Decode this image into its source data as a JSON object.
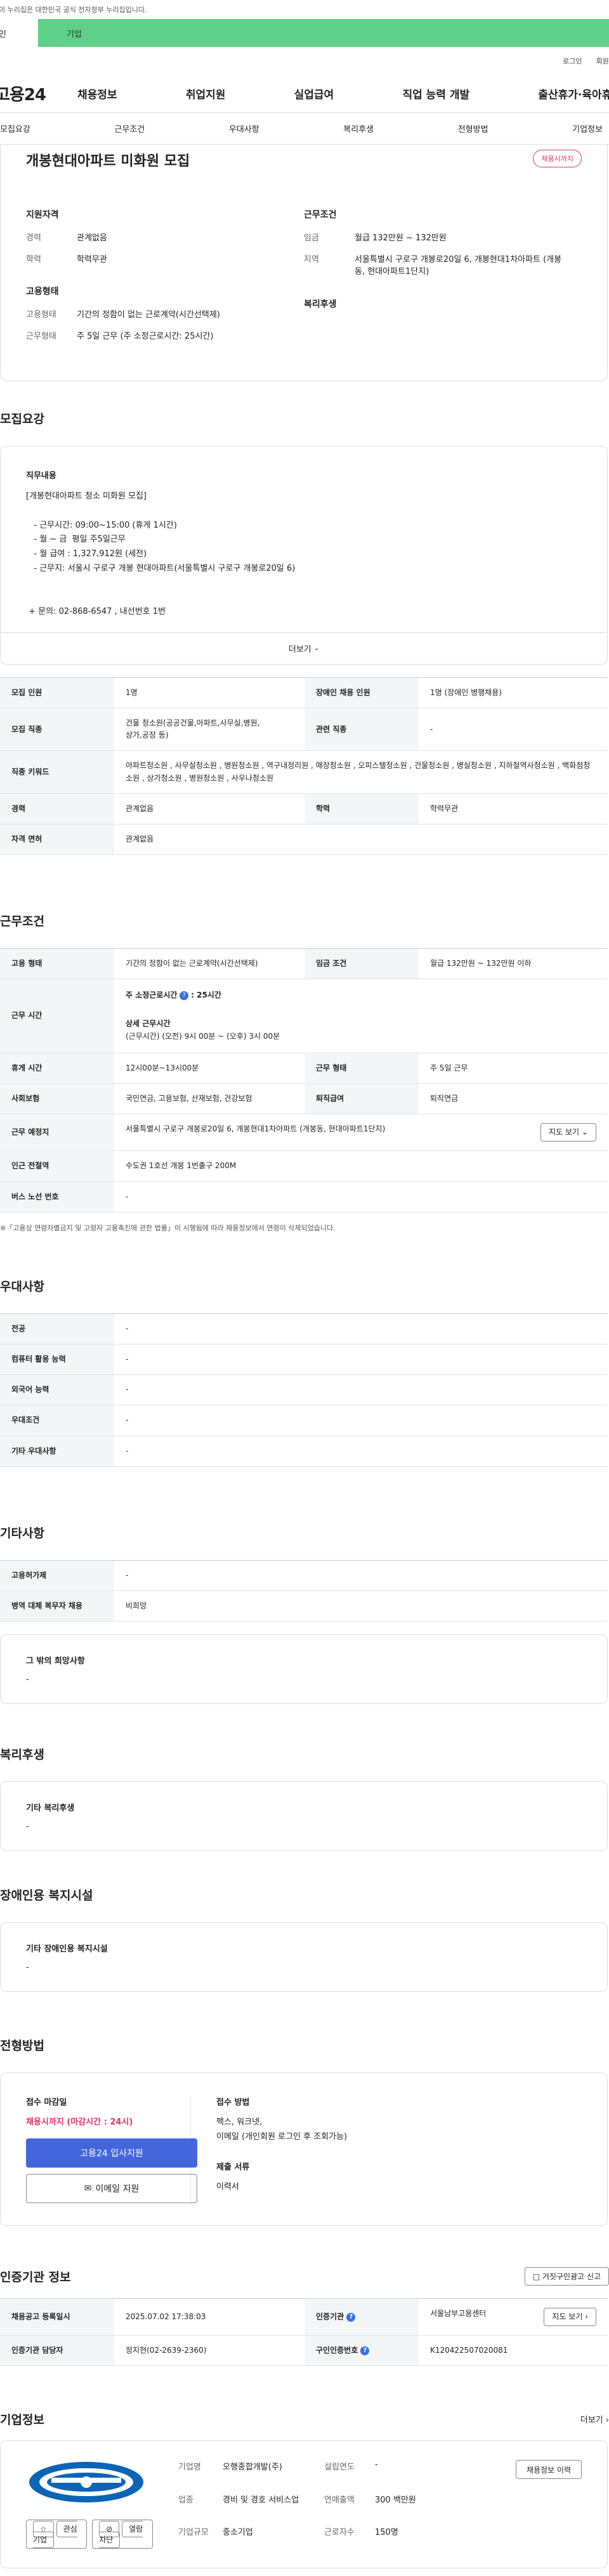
{
  "gov_banner": "이 누리집은 대한민국 공식 전자정부 누리집입니다.",
  "audience_tabs": {
    "individual": "개인",
    "business": "기업"
  },
  "util": {
    "login": "로그인",
    "join": "회원가입"
  },
  "logo": "고용24",
  "gnb": [
    "채용정보",
    "취업지원",
    "실업급여",
    "직업 능력 개발",
    "출산휴가·육아휴직"
  ],
  "subnav": [
    "모집요강",
    "근무조건",
    "우대사항",
    "복리후생",
    "전형방법",
    "기업정보"
  ],
  "summary": {
    "title": "개봉현대아파트 미화원 모집",
    "badge": "채용시까지",
    "qualification": {
      "heading": "지원자격",
      "items": [
        {
          "k": "경력",
          "v": "관계없음"
        },
        {
          "k": "학력",
          "v": "학력무관"
        }
      ]
    },
    "conditions": {
      "heading": "근무조건",
      "items": [
        {
          "k": "임금",
          "v": "월급 132만원 ~ 132만원"
        },
        {
          "k": "지역",
          "v": "서울특별시 구로구 개봉로20일 6, 개봉현대1차아파트 (개봉동, 현대아파트1단지)"
        }
      ]
    },
    "employment": {
      "heading": "고용형태",
      "items": [
        {
          "k": "고용형태",
          "v": "기간의 정함이 없는 근로계약(시간선택제)"
        },
        {
          "k": "근무형태",
          "v": "주 5일 근무 (주 소정근로시간: 25시간)"
        }
      ]
    },
    "welfare_heading": "복리후생"
  },
  "recruit": {
    "title": "모집요강",
    "duty_heading": "직무내용",
    "duty_lines": [
      "[개봉현대아파트 청소 미화원 모집]",
      "",
      "   - 근무시간: 09:00~15:00 (휴게 1시간)",
      "   - 월 ~ 금  평일 주5일근무",
      "   - 월 급여 : 1,327,912원 (세전)",
      "   - 근무지: 서울시 구로구 개봉 현대아파트(서울특별시 구로구 개봉로20일 6)",
      "",
      "",
      " + 문의: 02-868-6547 , 내선번호 1번"
    ],
    "more": "더보기",
    "rows": [
      {
        "k1": "모집 인원",
        "v1": "1명",
        "k2": "장애인 채용 인원",
        "v2": "1명 (장애인 병행채용)"
      },
      {
        "k1": "모집 직종",
        "v1": "건물 청소원(공공건물,아파트,사무실,병원,\n상가,공장 등)",
        "k2": "관련 직종",
        "v2": "-"
      },
      {
        "k1": "직종 키워드",
        "v1": "아파트청소원 , 사무실청소원 , 병원청소원 , 역구내정리원 , 매장청소원 , 오피스텔청소원 , 건물청소원 , 병실청소원 , 지하철역사청소원 , 백화점청소원 , 상가청소원 , 병원청소원 , 사우나청소원"
      },
      {
        "k1": "경력",
        "v1": "관계없음",
        "k2": "학력",
        "v2": "학력무관"
      },
      {
        "k1": "자격 면허",
        "v1": "관계없음"
      }
    ]
  },
  "work": {
    "title": "근무조건",
    "employment_k": "고용 형태",
    "employment_v": "기간의 정함이 없는 근로계약(시간선택제)",
    "wage_k": "임금 조건",
    "wage_v": "월급 132만원 ~ 132만원 이하",
    "hours_k": "근무 시간",
    "hours_weekly_label": "주 소정근로시간",
    "hours_weekly_value": ": 25시간",
    "hours_detail_label": "상세 근무시간",
    "hours_detail_value": "(근무시간) (오전) 9시 00분 ~ (오후) 3시 00분",
    "rest_k": "휴게 시간",
    "rest_v": "12시00분~13시00분",
    "form_k": "근무 형태",
    "form_v": "주 5일 근무",
    "ins_k": "사회보험",
    "ins_v": "국민연금, 고용보험, 산재보험, 건강보험",
    "sev_k": "퇴직급여",
    "sev_v": "퇴직연금",
    "place_k": "근무 예정지",
    "place_v": "서울특별시 구로구 개봉로20일 6, 개봉현대1차아파트 (개봉동, 현대아파트1단지)",
    "map_btn": "지도 보기",
    "subway_k": "인근 전철역",
    "subway_v": "수도권 1호선 개봉 1번출구 200M",
    "bus_k": "버스 노선 번호",
    "bus_v": "-",
    "note": "※「고용상 연령차별금지 및 고령자 고용촉진에 관한 법률」이 시행됨에 따라 채용정보에서 연령이 삭제되었습니다."
  },
  "preference": {
    "title": "우대사항",
    "rows": [
      {
        "k": "전공",
        "v": "-"
      },
      {
        "k": "컴퓨터 활용 능력",
        "v": "-"
      },
      {
        "k": "외국어 능력",
        "v": "-"
      },
      {
        "k": "우대조건",
        "v": "-"
      },
      {
        "k": "기타 우대사항",
        "v": "-"
      }
    ]
  },
  "etc": {
    "title": "기타사항",
    "rows": [
      {
        "k": "고용허가제",
        "v": "-"
      },
      {
        "k": "병역 대체 복무자 채용",
        "v": "비희망"
      }
    ],
    "other_heading": "그 밖의 희망사항",
    "other_value": "-"
  },
  "welfare": {
    "title": "복리후생",
    "heading": "기타 복리후생",
    "value": "-"
  },
  "disabled": {
    "title": "장애인용 복지시설",
    "heading": "기타 장애인용 복지시설",
    "value": "-"
  },
  "selection": {
    "title": "전형방법",
    "deadline_heading": "접수 마감일",
    "deadline": "채용시까지 (마감시간 : 24시)",
    "apply_btn": "고용24 입사지원",
    "email_btn": "이메일 지원",
    "method_heading": "접수 방법",
    "method_lines": [
      "팩스, 워크넷,",
      "이메일 (개인회원 로그인 후 조회가능)"
    ],
    "docs_heading": "제출 서류",
    "docs": "이력서"
  },
  "agency": {
    "title": "인증기관 정보",
    "report_btn": "거짓구인광고 신고",
    "date_k": "채용공고 등록일시",
    "date_v": "2025.07.02 17:38:03",
    "org_k": "인증기관",
    "org_v": "서울남부고용센터",
    "map_btn": "지도 보기",
    "mgr_k": "인증기관 담당자",
    "mgr_v": "정지현(02-2639-2360)",
    "no_k": "구인인증번호",
    "no_v": "K120422507020081"
  },
  "company": {
    "title": "기업정보",
    "more": "더보기",
    "fav_btn": "관심기업",
    "block_btn": "열람차단",
    "info": [
      {
        "k": "기업명",
        "v": "오행종합개발(주)",
        "k2": "설립연도",
        "v2": "-"
      },
      {
        "k": "업종",
        "v": "경비 및 경호 서비스업",
        "k2": "연매출액",
        "v2": "300 백만원"
      },
      {
        "k": "기업규모",
        "v": "중소기업",
        "k2": "근로자수",
        "v2": "150명"
      }
    ],
    "history_btn": "채용정보 이력",
    "logo_color": "#0b64b5"
  }
}
